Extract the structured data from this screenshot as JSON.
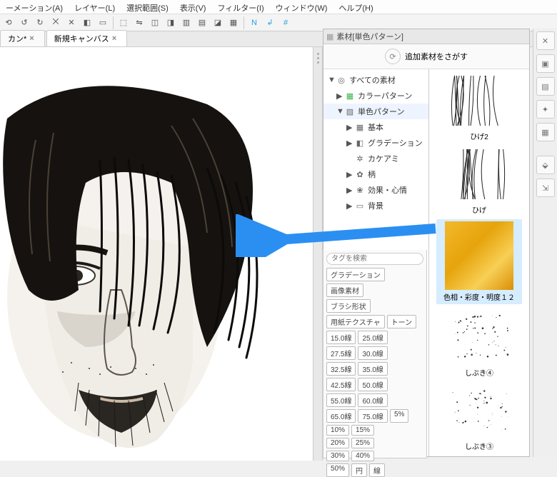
{
  "menu": [
    "ーメーション(A)",
    "レイヤー(L)",
    "選択範囲(S)",
    "表示(V)",
    "フィルター(I)",
    "ウィンドウ(W)",
    "ヘルプ(H)"
  ],
  "tabs": [
    {
      "label": "カン*"
    },
    {
      "label": "新規キャンバス"
    }
  ],
  "palette": {
    "title": "素材[単色パターン]",
    "add_label": "追加素材をさがす",
    "tree": [
      {
        "depth": 0,
        "tri": "▼",
        "icon": "◎",
        "label": "すべての素材"
      },
      {
        "depth": 1,
        "tri": "▶",
        "icon": "▦",
        "label": "カラーパターン",
        "iconColor": "#3bb34a"
      },
      {
        "depth": 1,
        "tri": "▼",
        "icon": "▨",
        "label": "単色パターン",
        "selected": true
      },
      {
        "depth": 2,
        "tri": "▶",
        "icon": "▦",
        "label": "基本"
      },
      {
        "depth": 2,
        "tri": "▶",
        "icon": "◧",
        "label": "グラデーション"
      },
      {
        "depth": 2,
        "tri": "",
        "icon": "✲",
        "label": "カケアミ"
      },
      {
        "depth": 2,
        "tri": "▶",
        "icon": "✿",
        "label": "柄"
      },
      {
        "depth": 2,
        "tri": "▶",
        "icon": "❀",
        "label": "効果・心情"
      },
      {
        "depth": 2,
        "tri": "▶",
        "icon": "▭",
        "label": "背景"
      }
    ]
  },
  "thumbs": [
    {
      "label": "ひげ2",
      "type": "strokes"
    },
    {
      "label": "ひげ",
      "type": "strokes"
    },
    {
      "label": "色相・彩度・明度１２",
      "type": "gold",
      "selected": true
    },
    {
      "label": "しぶき④",
      "type": "spatter"
    },
    {
      "label": "しぶき③",
      "type": "spatter"
    }
  ],
  "tags": {
    "main": [
      "グラデーション",
      "画像素材",
      "ブラシ形状"
    ],
    "split": [
      "用紙テクスチャ",
      "トーン"
    ],
    "grid": [
      [
        "15.0線",
        "25.0線"
      ],
      [
        "27.5線",
        "30.0線"
      ],
      [
        "32.5線",
        "35.0線"
      ],
      [
        "42.5線",
        "50.0線"
      ],
      [
        "55.0線",
        "60.0線"
      ],
      [
        "65.0線",
        "75.0線",
        "5%"
      ],
      [
        "10%",
        "15%"
      ],
      [
        "20%",
        "25%"
      ],
      [
        "30%",
        "40%"
      ],
      [
        "50%",
        "円",
        "線"
      ]
    ]
  },
  "search_placeholder": "タグを検索"
}
